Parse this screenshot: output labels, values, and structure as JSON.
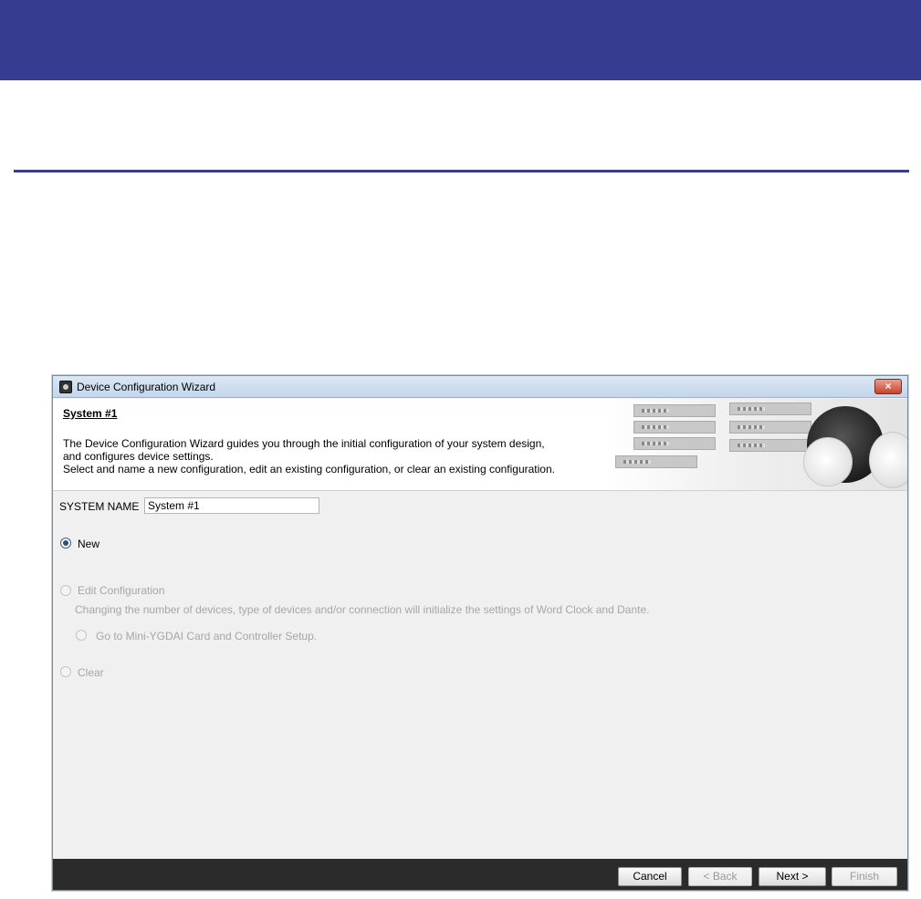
{
  "window": {
    "title": "Device Configuration Wizard",
    "close_symbol": "×"
  },
  "header": {
    "heading": "System #1",
    "description": [
      "The Device Configuration Wizard guides you through the initial configuration of your system design,",
      "and configures device settings.",
      "Select and name a new configuration, edit an existing configuration, or clear an existing configuration."
    ]
  },
  "system_name": {
    "label": "SYSTEM NAME",
    "value": "System #1"
  },
  "options": {
    "new_label": "New",
    "edit_label": "Edit Configuration",
    "edit_note": "Changing the number of devices, type of devices and/or connection will initialize the settings of Word Clock and Dante.",
    "goto_label": "Go to Mini-YGDAI Card and Controller Setup.",
    "clear_label": "Clear"
  },
  "footer": {
    "cancel_label": "Cancel",
    "back_label": "< Back",
    "next_label": "Next >",
    "finish_label": "Finish"
  },
  "colors": {
    "top_band": "#363c90",
    "rule_line": "#3a3d8f",
    "footer_bar": "#2b2b2b",
    "disabled_text": "#a6a6a6"
  }
}
